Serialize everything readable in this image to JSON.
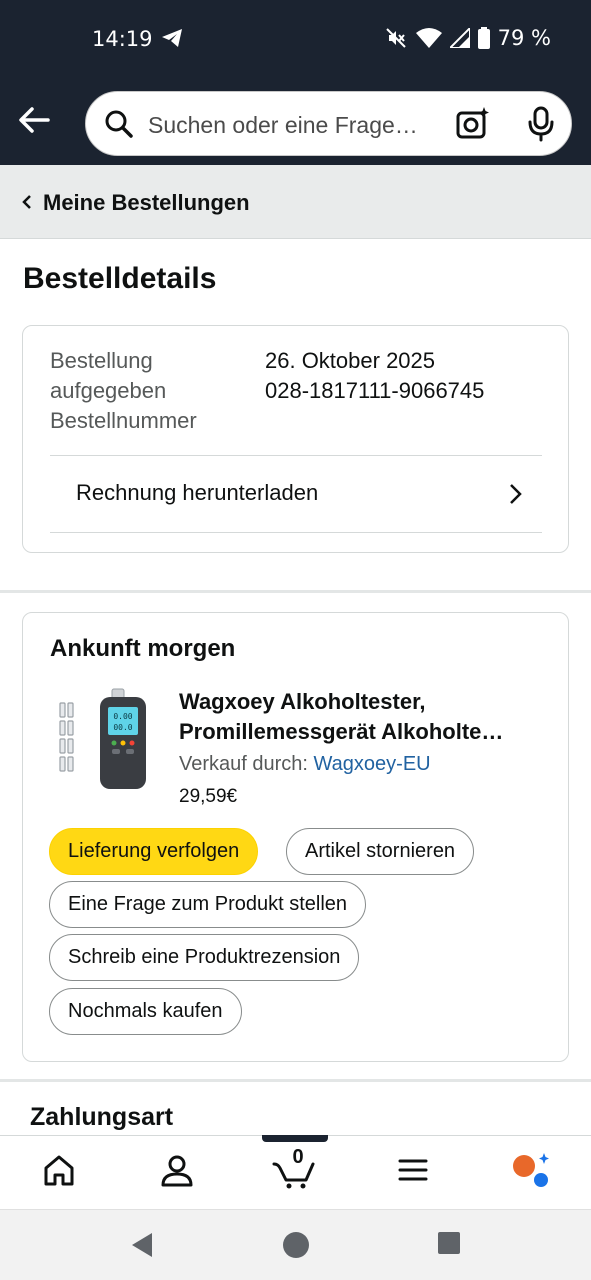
{
  "status_bar": {
    "time": "14:19",
    "battery": "79 %",
    "icons": [
      "telegram-icon",
      "mute-icon",
      "wifi-icon",
      "signal-icon",
      "battery-icon"
    ]
  },
  "header": {
    "search_placeholder": "Suchen oder eine Frage…",
    "icons": [
      "back-arrow-icon",
      "search-icon",
      "camera-sparkle-icon",
      "microphone-icon"
    ]
  },
  "breadcrumb": {
    "label": "Meine Bestellungen"
  },
  "page_title": "Bestelldetails",
  "order_details": {
    "placed_label_line1": "Bestellung",
    "placed_label_line2": "aufgegeben",
    "placed_value": "26. Oktober 2025",
    "number_label": "Bestellnummer",
    "number_value": "028-1817111-9066745",
    "invoice_label": "Rechnung herunterladen"
  },
  "shipment": {
    "heading": "Ankunft morgen",
    "product_title_line1": "Wagxoey Alkoholtester,",
    "product_title_line2": "Promillemessgerät Alkoholte…",
    "sold_by_label": "Verkauf durch:",
    "seller": "Wagxoey-EU",
    "price": "29,59€",
    "buttons": {
      "track": "Lieferung verfolgen",
      "cancel": "Artikel stornieren",
      "question": "Eine Frage zum Produkt stellen",
      "review": "Schreib eine Produktrezension",
      "buy_again": "Nochmals kaufen"
    }
  },
  "payment": {
    "heading": "Zahlungsart"
  },
  "bottom_nav": {
    "cart_count": "0",
    "tabs": [
      "home-icon",
      "account-icon",
      "cart-icon",
      "menu-icon",
      "rufus-icon"
    ]
  },
  "colors": {
    "header_bg": "#1b2330",
    "primary_button": "#ffd814",
    "link": "#2162a1",
    "rufus_orange": "#e8682a",
    "rufus_blue": "#1a73e8"
  }
}
